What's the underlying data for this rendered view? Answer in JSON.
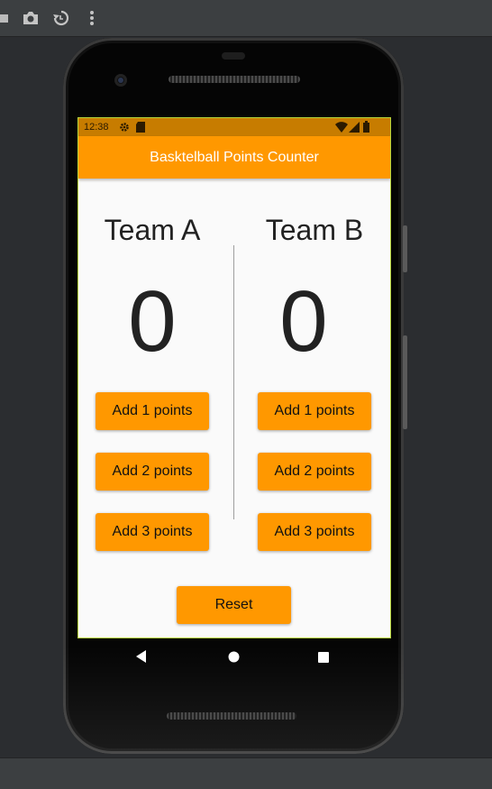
{
  "status_bar": {
    "time": "12:38"
  },
  "app_bar": {
    "title": "Basktelball Points Counter"
  },
  "team_a": {
    "name": "Team A",
    "score": "0",
    "buttons": [
      "Add 1 points",
      "Add 2 points",
      "Add 3 points"
    ]
  },
  "team_b": {
    "name": "Team B",
    "score": "0",
    "buttons": [
      "Add 1 points",
      "Add 2 points",
      "Add 3 points"
    ]
  },
  "reset_label": "Reset",
  "colors": {
    "accent": "#ff9800",
    "status_bar": "#c77c00",
    "background": "#fafafa"
  },
  "icons": [
    "camera-icon",
    "rotate-icon",
    "more-vert-icon",
    "settings-icon",
    "sd-card-icon",
    "wifi-icon",
    "signal-icon",
    "battery-icon",
    "back-icon",
    "home-icon",
    "recents-icon"
  ]
}
